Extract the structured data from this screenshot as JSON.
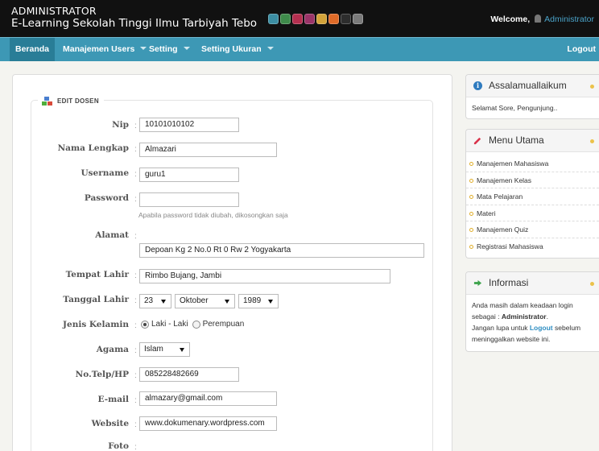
{
  "header": {
    "role": "ADMINISTRATOR",
    "site_title": "E-Learning Sekolah Tinggi Ilmu Tarbiyah Tebo",
    "welcome_label": "Welcome,",
    "username": "Administrator",
    "theme_colors": [
      "#3c8ea3",
      "#3f8b4b",
      "#b42f4f",
      "#9a3468",
      "#d3a33a",
      "#e06b28",
      "#2d2d2d",
      "#7a7a7a"
    ]
  },
  "nav": {
    "items": [
      {
        "label": "Beranda"
      },
      {
        "label": "Manajemen Users"
      },
      {
        "label": "Setting"
      },
      {
        "label": "Setting Ukuran"
      }
    ],
    "logout": "Logout"
  },
  "form": {
    "title": "EDIT DOSEN",
    "labels": {
      "nip": "Nip",
      "nama": "Nama Lengkap",
      "username": "Username",
      "password": "Password",
      "alamat": "Alamat",
      "tempat": "Tempat Lahir",
      "tanggal": "Tanggal Lahir",
      "jk": "Jenis Kelamin",
      "agama": "Agama",
      "telp": "No.Telp/HP",
      "email": "E-mail",
      "website": "Website",
      "foto": "Foto"
    },
    "colon": ":",
    "values": {
      "nip": "10101010102",
      "nama": "Almazari",
      "username": "guru1",
      "password": "",
      "alamat": "Depoan Kg 2 No.0 Rt 0 Rw 2 Yogyakarta",
      "tempat": "Rimbo Bujang, Jambi",
      "day": "23",
      "month": "Oktober",
      "year": "1989",
      "agama": "Islam",
      "telp": "085228482669",
      "email": "almazary@gmail.com",
      "website": "www.dokumenary.wordpress.com"
    },
    "password_hint": "Apabila password tidak diubah, dikosongkan saja",
    "gender": {
      "male": "Laki - Laki",
      "female": "Perempuan",
      "selected": "male"
    }
  },
  "sidebar": {
    "greeting": {
      "title": "Assalamuallaikum",
      "text": "Selamat Sore, Pengunjung.."
    },
    "menu": {
      "title": "Menu Utama",
      "items": [
        "Manajemen Mahasiswa",
        "Manajemen Kelas",
        "Mata Pelajaran",
        "Materi",
        "Manajemen Quiz",
        "Registrasi Mahasiswa"
      ]
    },
    "info": {
      "title": "Informasi",
      "line1": "Anda masih dalam keadaan login",
      "line2_pre": "sebagai : ",
      "line2_user": "Administrator",
      "line2_post": ".",
      "line3_pre": "Jangan lupa untuk ",
      "line3_link": "Logout",
      "line3_post": " sebelum",
      "line4": "meninggalkan website ini."
    }
  }
}
